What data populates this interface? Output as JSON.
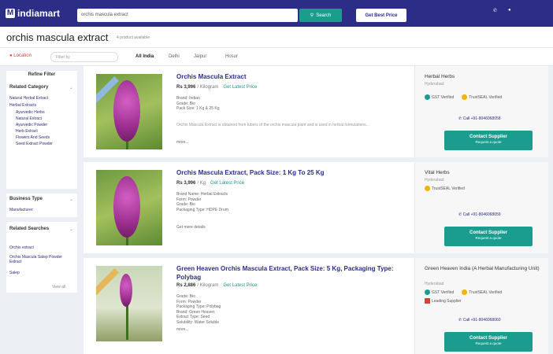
{
  "header": {
    "logo_text": "indiamart",
    "search_value": "orchis mascula extract",
    "search_button": "Search",
    "get_best_price": "Get Best Price",
    "icons": [
      "phone-icon",
      "user-icon"
    ]
  },
  "page": {
    "title": "orchis mascula extract",
    "count": "4 product available"
  },
  "filters": {
    "location": "Location",
    "filter_placeholder": "Filter by",
    "tabs": [
      "All India",
      "Delhi",
      "Jaipur",
      "Hosur"
    ]
  },
  "sidebar": {
    "refine": "Refine Filter",
    "related_category": "Related Category",
    "category_items": [
      "Natural Herbal Extract",
      "Herbal Extracts",
      "Ayurvedic Herbs",
      "Natural Extract",
      "Ayurvedic Powder",
      "Herb Extract",
      "Flowers And Seeds",
      "Seed Extract Powder"
    ],
    "business_type": "Business Type",
    "business_items": [
      "Manufacturer"
    ],
    "related_searches": "Related Searches",
    "related_items": [
      "Orchis extract",
      "Orchis Mascula Salep Powder Extract",
      "Salep",
      "View all"
    ]
  },
  "listings": [
    {
      "title": "Orchis Mascula Extract",
      "price": "Rs 3,996",
      "unit": "/ Kilogram",
      "price_link": "Get Latest Price",
      "specs": [
        "Brand: Indian",
        "Grade: Bio",
        "Pack Size: 1 Kg & 25 Kg"
      ],
      "desc": "Orchis Mascula Extract is obtained from tubers of the orchis mascula plant and is used in herbal formulations...",
      "more": "more...",
      "supplier": "Herbal Herbs",
      "supplier_loc": "Hyderabad",
      "badges": [
        "GST Verified",
        "TrustSEAL Verified"
      ],
      "call": "Call +91-8046068058",
      "contact": "Contact Supplier",
      "contact_sub": "Request a quote"
    },
    {
      "title": "Orchis Mascula Extract, Pack Size: 1 Kg To 25 Kg",
      "price": "Rs 3,996",
      "unit": "/ Kg",
      "price_link": "Get Latest Price",
      "specs": [
        "Brand Name: Herbal Extracts",
        "Form: Powder",
        "Grade: Bio",
        "Packaging Type: HDPE Drum"
      ],
      "desc": "",
      "more": "Get more details",
      "supplier": "Vital Herbs",
      "supplier_loc": "Hyderabad",
      "badges": [
        "TrustSEAL Verified"
      ],
      "call": "Call +91-8046068059",
      "contact": "Contact Supplier",
      "contact_sub": "Request a quote"
    },
    {
      "title": "Green Heaven Orchis Mascula Extract, Pack Size: 5 Kg, Packaging Type: Polybag",
      "price": "Rs 2,886",
      "unit": "/ Kilogram",
      "price_link": "Get Latest Price",
      "specs": [
        "Grade: Bio",
        "Form: Powder",
        "Packaging Type: Polybag",
        "Brand: Green Heaven",
        "Extract Type: Seed",
        "Solubility: Water Soluble"
      ],
      "desc": "",
      "more": "more...",
      "supplier": "Green Heaven India (A Herbal Manufacturing Unit)",
      "supplier_loc": "Hyderabad",
      "badges": [
        "GST Verified",
        "TrustSEAL Verified",
        "Leading Supplier"
      ],
      "call": "Call +91-8046068060",
      "contact": "Contact Supplier",
      "contact_sub": "Request a quote"
    }
  ],
  "colors": {
    "header": "#2b2d86",
    "accent": "#1a9d8e",
    "link": "#2b2d86",
    "badge_gst": "#1a9d8e",
    "badge_trust": "#f0b400",
    "badge_lead": "#e53935"
  }
}
